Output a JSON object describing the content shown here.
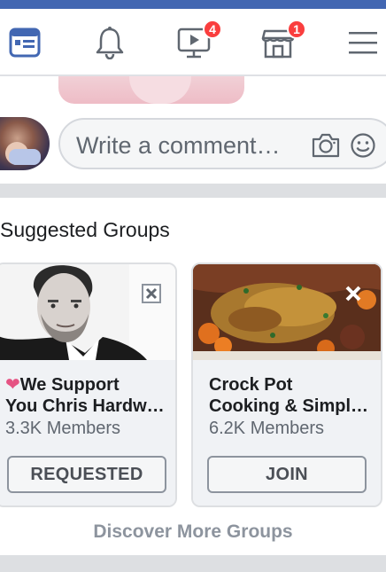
{
  "colors": {
    "brand": "#4267b2",
    "badge": "#fa3e3e",
    "divider": "#dddfe2",
    "heart": "#e55383"
  },
  "navbar": {
    "items": [
      {
        "icon": "news-feed-icon",
        "active": true
      },
      {
        "icon": "bell-icon"
      },
      {
        "icon": "watch-video-icon",
        "badge": "4"
      },
      {
        "icon": "marketplace-icon",
        "badge": "1"
      },
      {
        "icon": "hamburger-menu-icon"
      }
    ]
  },
  "comment": {
    "placeholder": "Write a comment…",
    "camera_icon": "camera-icon",
    "emoji_icon": "smiley-icon"
  },
  "suggested": {
    "title": "Suggested Groups",
    "cards": [
      {
        "heart": "❤",
        "name_line1": "We Support",
        "name_line2": "You Chris Hardw…",
        "members": "3.3K Members",
        "button": "REQUESTED"
      },
      {
        "name_line1": "Crock Pot",
        "name_line2": "Cooking & Simpl…",
        "members": "6.2K Members",
        "button": "JOIN"
      }
    ],
    "discover": "Discover More Groups"
  }
}
